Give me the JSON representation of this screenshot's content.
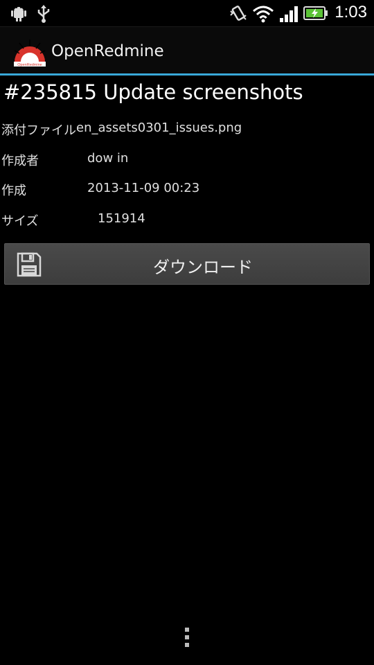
{
  "status_bar": {
    "clock": "1:03",
    "icons": [
      "android-debug-icon",
      "usb-icon",
      "vibrate-icon",
      "wifi-icon",
      "signal-icon",
      "battery-charging-icon"
    ]
  },
  "action_bar": {
    "app_title": "OpenRedmine",
    "logo_text": "OpenRedmine",
    "divider_color": "#39a9d9"
  },
  "issue": {
    "title": "#235815 Update screenshots"
  },
  "details": {
    "attachment_label": "添付ファイル",
    "attachment_value": "en_assets0301_issues.png",
    "author_label": "作成者",
    "author_value": "dow in",
    "created_label": "作成",
    "created_value": "2013-11-09 00:23",
    "size_label": "サイズ",
    "size_value": "151914"
  },
  "download_button": {
    "label": "ダウンロード",
    "icon": "save-icon"
  },
  "menu": {
    "icon": "overflow-menu-icon"
  }
}
